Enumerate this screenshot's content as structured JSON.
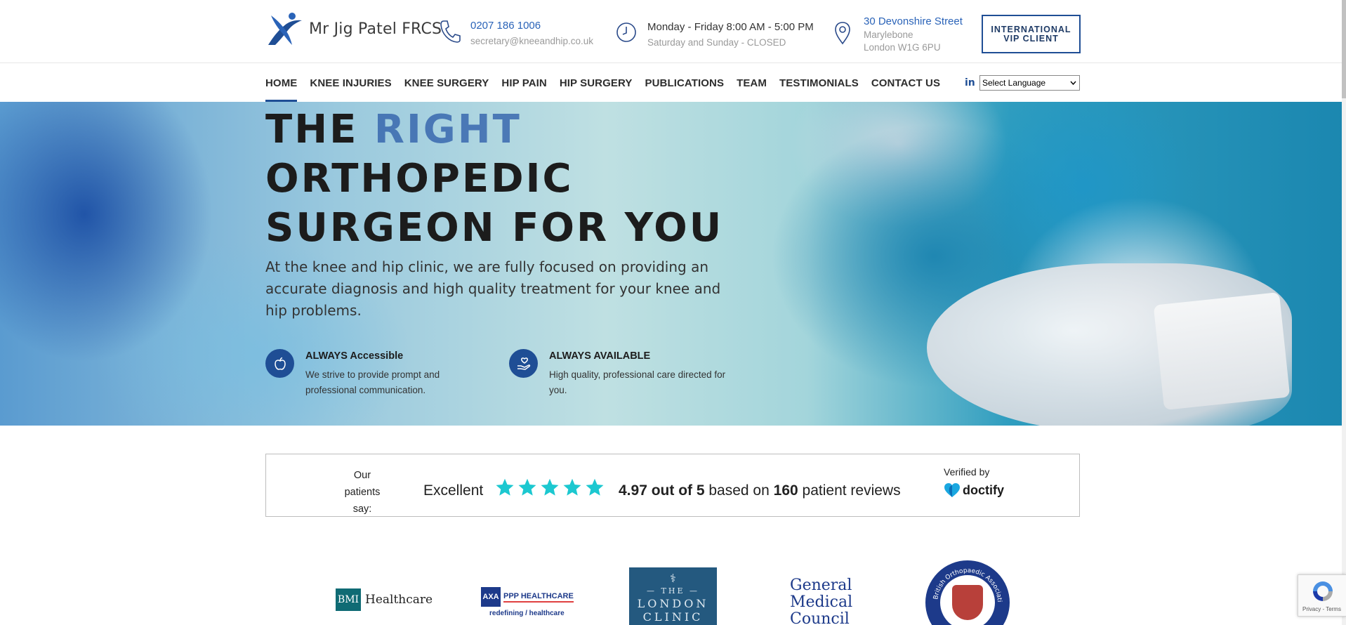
{
  "header": {
    "logo_text": "Mr Jig Patel FRCS",
    "phone": "0207 186 1006",
    "email": "secretary@kneeandhip.co.uk",
    "hours_weekday": "Monday - Friday 8:00 AM - 5:00 PM",
    "hours_weekend": "Saturday and Sunday - CLOSED",
    "address_line1": "30 Devonshire Street",
    "address_line2": "Marylebone",
    "address_line3": "London W1G 6PU",
    "vip_button_line1": "INTERNATIONAL",
    "vip_button_line2": "VIP CLIENT"
  },
  "nav": {
    "items": [
      {
        "label": "HOME",
        "active": true
      },
      {
        "label": "KNEE INJURIES"
      },
      {
        "label": "KNEE SURGERY"
      },
      {
        "label": "HIP PAIN"
      },
      {
        "label": "HIP SURGERY"
      },
      {
        "label": "PUBLICATIONS"
      },
      {
        "label": "TEAM"
      },
      {
        "label": "TESTIMONIALS"
      },
      {
        "label": "CONTACT US"
      }
    ],
    "linkedin_label": "in",
    "language_select": "Select Language"
  },
  "hero": {
    "title_word1": "THE",
    "title_word2": "RIGHT",
    "title_line2": "ORTHOPEDIC",
    "title_line3": "SURGEON FOR YOU",
    "subtitle": "At the knee and hip clinic, we are fully focused on providing an accurate diagnosis and high quality treatment for your knee and hip problems.",
    "features": [
      {
        "title": "ALWAYS Accessible",
        "text": "We strive to provide prompt and professional communication.",
        "icon": "apple-icon"
      },
      {
        "title": "ALWAYS AVAILABLE",
        "text": "High quality, professional care directed for you.",
        "icon": "care-hand-icon"
      }
    ]
  },
  "reviews": {
    "our_line1": "Our",
    "our_line2": "patients say:",
    "rating_word": "Excellent",
    "star_count": 5,
    "star_color": "#1cc8d0",
    "score": "4.97 out of 5",
    "based_on": "based on",
    "review_count": "160",
    "review_suffix": "patient reviews",
    "verified_by": "Verified by",
    "verifier": "doctify"
  },
  "partners": {
    "bmi_box": "BMI",
    "bmi_name": "Healthcare",
    "axa_box": "AXA",
    "axa_name": "PPP HEALTHCARE",
    "axa_tag": "redefining / healthcare",
    "london_symbol": "⚕",
    "london_the": "— THE —",
    "london_name": "LONDON CLINIC",
    "gmc_line1": "General",
    "gmc_line2": "Medical",
    "gmc_line3": "Council",
    "boa_name": "British Orthopaedic Association"
  },
  "recaptcha": {
    "text": "Privacy - Terms"
  },
  "colors": {
    "brand_blue": "#1f4e95",
    "link_blue": "#2a63b8"
  }
}
